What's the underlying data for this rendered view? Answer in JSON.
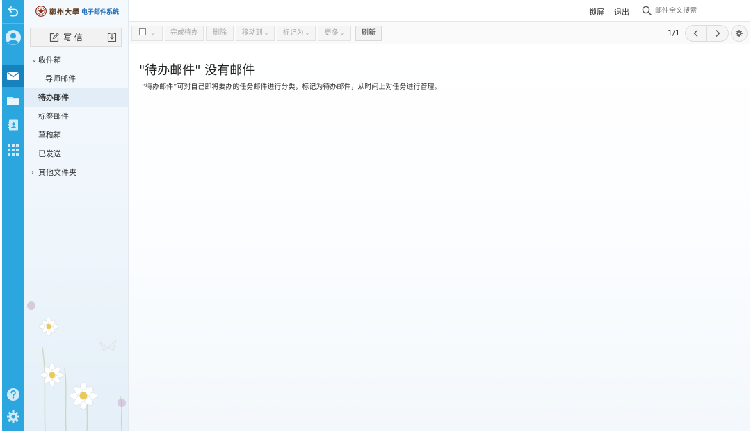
{
  "rail": {
    "items": [
      {
        "name": "back-icon"
      },
      {
        "name": "avatar"
      },
      {
        "name": "mail-icon"
      },
      {
        "name": "folder-icon"
      },
      {
        "name": "contacts-icon"
      },
      {
        "name": "apps-grid-icon"
      },
      {
        "name": "help-icon"
      },
      {
        "name": "gear-icon"
      }
    ],
    "accent": "#2ba6df",
    "active": "#1683bf"
  },
  "logo": {
    "name": "鄭州大學",
    "subtitle": "电子邮件系统"
  },
  "sidebar": {
    "compose_label": "写 信",
    "folders": [
      {
        "label": "收件箱",
        "level": "top",
        "expanded": true
      },
      {
        "label": "导师邮件",
        "level": "sub"
      },
      {
        "label": "待办邮件",
        "level": "top",
        "active": true
      },
      {
        "label": "标签邮件",
        "level": "top"
      },
      {
        "label": "草稿箱",
        "level": "top"
      },
      {
        "label": "已发送",
        "level": "top"
      },
      {
        "label": "其他文件夹",
        "level": "top",
        "expanded": false
      }
    ]
  },
  "header": {
    "lock_label": "锁屏",
    "logout_label": "退出",
    "search_placeholder": "邮件全文搜索"
  },
  "toolbar": {
    "complete_label": "完成待办",
    "delete_label": "删除",
    "move_label": "移动到",
    "mark_label": "标记为",
    "more_label": "更多",
    "refresh_label": "刷新",
    "page_info": "1/1"
  },
  "main": {
    "empty_title": "\"待办邮件\" 没有邮件",
    "empty_desc": "“待办邮件”可对自己即将要办的任务邮件进行分类，标记为待办邮件，从时间上对任务进行管理。"
  }
}
